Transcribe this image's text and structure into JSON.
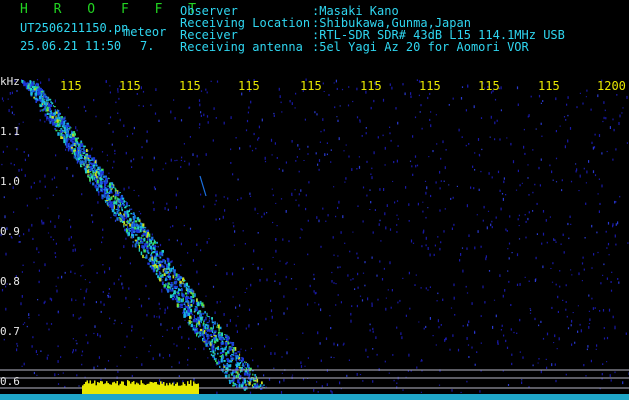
{
  "header": {
    "app_name": "H R O F F T",
    "file_name": "UT2506211150.pn",
    "mode": "meteor",
    "timestamp": "25.06.21 11:50",
    "count": "7.",
    "fields": [
      {
        "label": "Observer",
        "value": ":Masaki Kano"
      },
      {
        "label": "Receiving Location",
        "value": ":Shibukawa,Gunma,Japan"
      },
      {
        "label": "Receiver",
        "value": ":RTL-SDR SDR# 43dB L15 114.1MHz USB"
      },
      {
        "label": "Receiving antenna",
        "value": ":5el Yagi Az 20 for Aomori VOR"
      }
    ]
  },
  "axis": {
    "y_unit": "kHz",
    "y_ticks": [
      "1.1",
      "1.0",
      "0.9",
      "0.8",
      "0.7",
      "0.6"
    ],
    "x_ticks": [
      "115",
      "115",
      "115",
      "115",
      "115",
      "115",
      "115",
      "115",
      "115",
      "1200"
    ]
  },
  "colors": {
    "background": "#000000",
    "brand": "#22d422",
    "header_text": "#2fd6f0",
    "tick_text": "#e8e800",
    "noise": "#1a1aa8",
    "signal_hot": "#e8e800"
  }
}
